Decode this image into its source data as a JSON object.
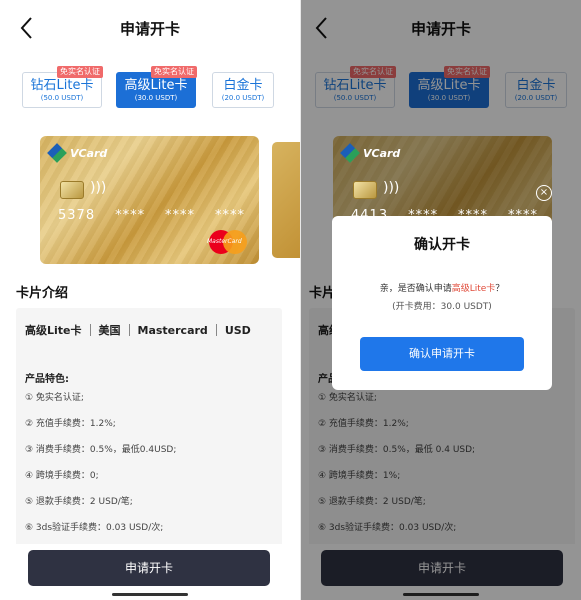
{
  "header": {
    "title": "申请开卡"
  },
  "tabs": [
    {
      "name": "钻石Lite卡",
      "sub": "(50.0 USDT)",
      "badge": "免实名认证"
    },
    {
      "name": "高级Lite卡",
      "sub": "(30.0 USDT)",
      "badge": "免实名认证"
    },
    {
      "name": "白金卡",
      "sub": "(20.0 USDT)",
      "badge": ""
    }
  ],
  "card": {
    "brand": "VCard",
    "number_left": [
      "5378",
      "****",
      "****",
      "****"
    ],
    "number_right": [
      "4413",
      "****",
      "****",
      "****"
    ],
    "network": "MasterCard"
  },
  "intro": {
    "title": "卡片介绍",
    "spec": [
      "高级Lite卡",
      "美国",
      "Mastercard",
      "USD"
    ],
    "features_title": "产品特色:",
    "features_left": [
      "① 免实名认证;",
      "② 充值手续费：1.2%;",
      "③ 消费手续费：0.5%，最低0.4USD;",
      "④ 跨境手续费：0;",
      "⑤ 退款手续费：2 USD/笔;",
      "⑥ 3ds验证手续费：0.03 USD/次;"
    ],
    "features_right": [
      "① 免实名认证;",
      "② 充值手续费：1.2%;",
      "③ 消费手续费：0.5%，最低 0.4 USD;",
      "④ 跨境手续费：1%;",
      "⑤ 退款手续费：2 USD/笔;",
      "⑥ 3ds验证手续费：0.03 USD/次;"
    ]
  },
  "apply_button": "申请开卡",
  "dialog": {
    "title": "确认开卡",
    "msg_prefix": "亲，是否确认申请",
    "msg_highlight": "高级Lite卡",
    "msg_suffix": "？",
    "fee": "(开卡费用：30.0 USDT)",
    "confirm": "确认申请开卡"
  }
}
